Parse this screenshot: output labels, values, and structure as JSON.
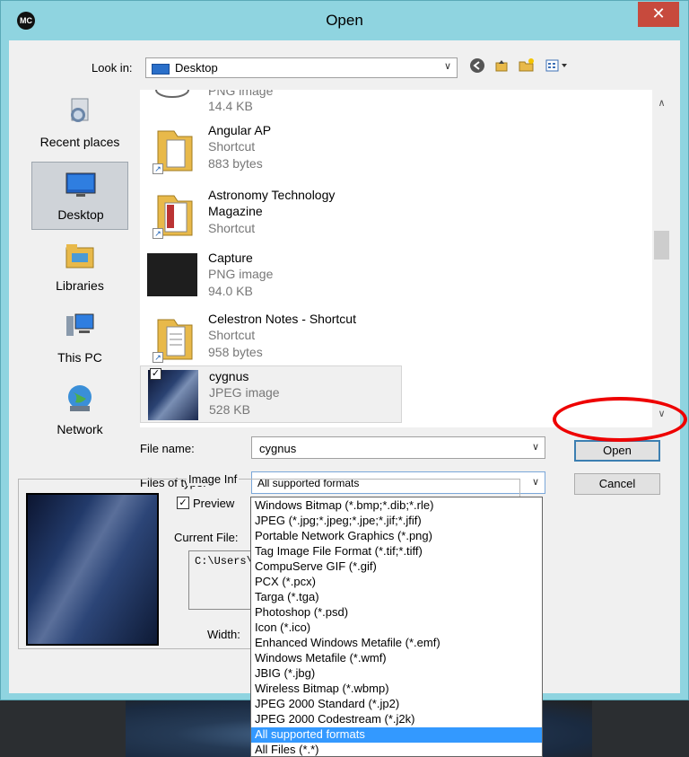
{
  "window": {
    "title": "Open",
    "app_badge": "MC",
    "close_label": "✕"
  },
  "lookin": {
    "label": "Look in:",
    "value": "Desktop"
  },
  "places": [
    {
      "name": "place-recent",
      "label": "Recent places",
      "icon": "recent-places-icon"
    },
    {
      "name": "place-desktop",
      "label": "Desktop",
      "icon": "desktop-icon"
    },
    {
      "name": "place-libraries",
      "label": "Libraries",
      "icon": "libraries-icon"
    },
    {
      "name": "place-thispc",
      "label": "This PC",
      "icon": "computer-icon"
    },
    {
      "name": "place-network",
      "label": "Network",
      "icon": "network-icon"
    }
  ],
  "files": [
    {
      "name": "",
      "type": "PNG image",
      "detail": "14.4 KB"
    },
    {
      "name": "Angular AP",
      "type": "Shortcut",
      "detail": "883 bytes"
    },
    {
      "name": "Astronomy Technology",
      "name2": "Magazine",
      "type": "Shortcut",
      "detail": ""
    },
    {
      "name": "Capture",
      "type": "PNG image",
      "detail": "94.0 KB"
    },
    {
      "name": "Celestron Notes - Shortcut",
      "type": "Shortcut",
      "detail": "958 bytes"
    },
    {
      "name": "cygnus",
      "type": "JPEG image",
      "detail": "528 KB"
    }
  ],
  "filename": {
    "label": "File name:",
    "value": "cygnus"
  },
  "filetype": {
    "label": "Files of type:",
    "value": "All supported formats"
  },
  "buttons": {
    "open": "Open",
    "cancel": "Cancel"
  },
  "preview": {
    "image_info_label": "Image Inf",
    "preview_label": "Preview",
    "current_file_label": "Current File:",
    "current_file_value": "C:\\Users\\",
    "width_label": "Width:"
  },
  "type_options": [
    "Windows Bitmap (*.bmp;*.dib;*.rle)",
    "JPEG (*.jpg;*.jpeg;*.jpe;*.jif;*.jfif)",
    "Portable Network Graphics (*.png)",
    "Tag Image File Format (*.tif;*.tiff)",
    "CompuServe GIF (*.gif)",
    "PCX (*.pcx)",
    "Targa (*.tga)",
    "Photoshop (*.psd)",
    "Icon (*.ico)",
    "Enhanced Windows Metafile (*.emf)",
    "Windows Metafile (*.wmf)",
    "JBIG (*.jbg)",
    "Wireless Bitmap (*.wbmp)",
    "JPEG 2000 Standard (*.jp2)",
    "JPEG 2000 Codestream (*.j2k)",
    "All supported formats",
    "All Files (*.*)"
  ],
  "selected_type_index": 15,
  "colors": {
    "titlebar": "#8fd4e0",
    "close": "#c74a3d",
    "selection": "#3399ff",
    "highlight_circle": "#ee0000"
  }
}
